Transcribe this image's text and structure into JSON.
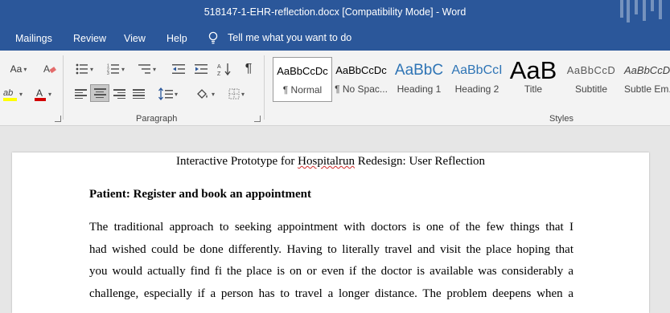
{
  "window": {
    "title": "518147-1-EHR-reflection.docx [Compatibility Mode]  -  Word"
  },
  "tabs": [
    "Mailings",
    "Review",
    "View",
    "Help"
  ],
  "tell_me": "Tell me what you want to do",
  "ribbon": {
    "font_group": {
      "change_case_label": "Aa"
    },
    "paragraph_group": {
      "label": "Paragraph",
      "show_marks_glyph": "¶"
    },
    "styles_group": {
      "label": "Styles",
      "styles": [
        {
          "preview": "AaBbCcDc",
          "label": "¶ Normal",
          "selected": true
        },
        {
          "preview": "AaBbCcDc",
          "label": "¶ No Spac...",
          "selected": false
        },
        {
          "preview": "AaBbC",
          "label": "Heading 1",
          "selected": false
        },
        {
          "preview": "AaBbCcI",
          "label": "Heading 2",
          "selected": false
        },
        {
          "preview": "AaB",
          "label": "Title",
          "selected": false
        },
        {
          "preview": "AaBbCcD",
          "label": "Subtitle",
          "selected": false
        },
        {
          "preview": "AaBbCcD",
          "label": "Subtle Em...",
          "selected": false
        }
      ]
    },
    "colors": {
      "highlight": "#ffff00",
      "font_color": "#d20000",
      "accent": "#2b579a"
    }
  },
  "document": {
    "heading_before": "Interactive Prototype for ",
    "heading_misspelled": "Hospitalrun",
    "heading_after": " Redesign: User Reflection",
    "section_heading": "Patient: Register and book an appointment",
    "paragraph_lines": [
      "The traditional approach to seeking appointment with doctors is one of the few things that I",
      "had wished could be done differently. Having to literally travel and visit the place hoping that",
      "you would actually find fi the place is on or even if the doctor is available was considerably a",
      "challenge, especially if a person has to travel a longer distance. The problem deepens when a"
    ]
  }
}
